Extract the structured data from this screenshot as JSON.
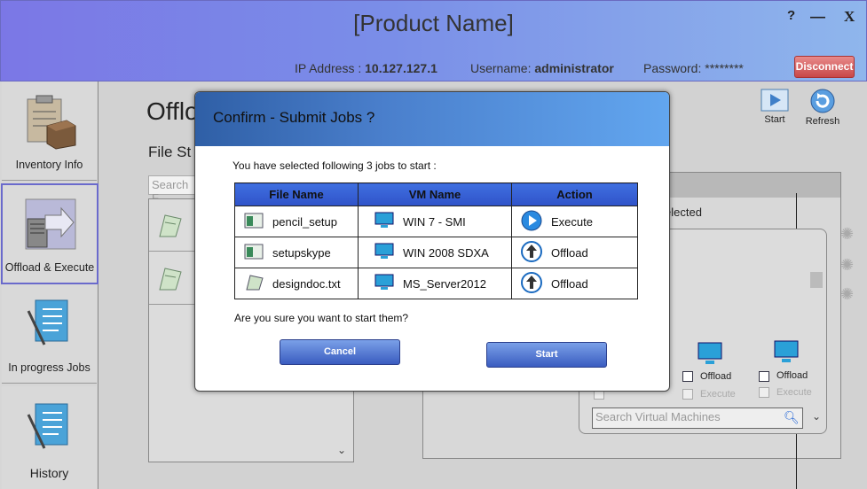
{
  "header": {
    "product_name": "[Product Name]",
    "help": "?",
    "minimize": "—",
    "close": "X",
    "ip_label": "IP Address :",
    "ip_value": "10.127.127.1",
    "user_label": "Username:",
    "user_value": "administrator",
    "password_label": "Password:",
    "password_value": "********",
    "disconnect": "Disconnect"
  },
  "sidebar": {
    "items": [
      {
        "label": "Inventory Info",
        "icon": "clipboard-box-icon"
      },
      {
        "label": "Offload & Execute",
        "icon": "server-arrow-icon"
      },
      {
        "label": "In progress Jobs",
        "icon": "checklist-pen-icon"
      },
      {
        "label": "History",
        "icon": "checklist-pen-icon"
      }
    ]
  },
  "main": {
    "title": "Offlo",
    "file_store_label": "File St",
    "search_files_placeholder": "Search F",
    "toolbar": {
      "start": "Start",
      "refresh": "Refresh"
    },
    "selected_text": "elected",
    "vm_cards": [
      {
        "offload": "Offload",
        "execute": "Execute"
      },
      {
        "offload": "Offload",
        "execute": "Execute"
      }
    ],
    "search_vm_placeholder": "Search Virtual Machines"
  },
  "dialog": {
    "title": "Confirm - Submit Jobs ?",
    "intro": "You have selected following 3 jobs to start :",
    "columns": [
      "File Name",
      "VM Name",
      "Action"
    ],
    "rows": [
      {
        "file": "pencil_setup",
        "vm": "WIN 7 - SMI",
        "action": "Execute"
      },
      {
        "file": "setupskype",
        "vm": "WIN 2008 SDXA",
        "action": "Offload"
      },
      {
        "file": "designdoc.txt",
        "vm": "MS_Server2012",
        "action": "Offload"
      }
    ],
    "question": "Are you sure you want to start them?",
    "cancel": "Cancel",
    "start": "Start"
  },
  "colors": {
    "header_start": "#7b77e6",
    "header_end": "#8fb6ec",
    "dialog_title": "#4a7fcc",
    "table_header": "#3f6fe0",
    "disconnect": "#c84848"
  }
}
